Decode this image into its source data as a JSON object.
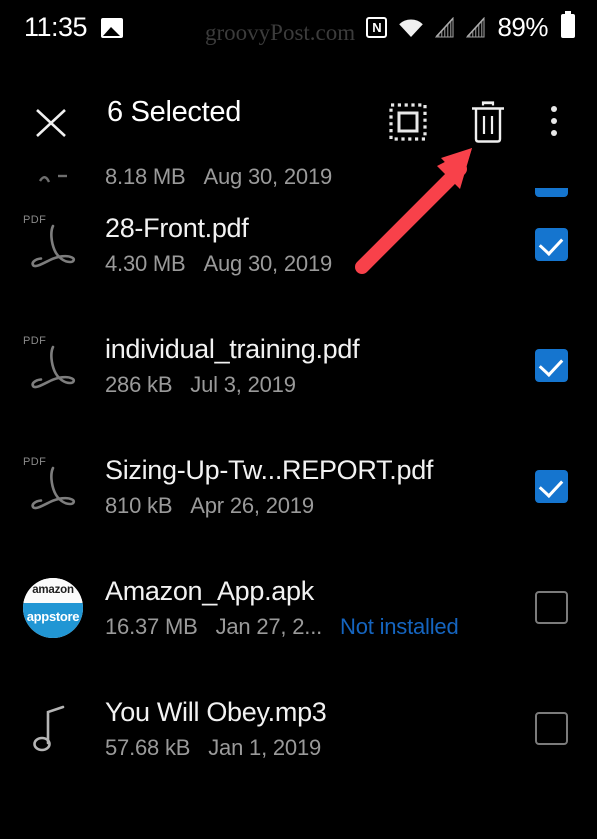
{
  "status_bar": {
    "time": "11:35",
    "battery_percent": "89%",
    "icons": [
      "image-icon",
      "nfc-icon",
      "wifi-icon",
      "signal-off-icon",
      "signal-off-icon",
      "battery-icon"
    ]
  },
  "watermark": {
    "text": "groovyPost.com"
  },
  "action_bar": {
    "close_label": "close-icon",
    "title": "6 Selected",
    "select_all_label": "select-all-icon",
    "delete_label": "delete-icon",
    "overflow_label": "more-options-icon"
  },
  "colors": {
    "accent_blue": "#1575cf",
    "link_blue": "#1565c0",
    "arrow_red": "#f8414a",
    "background": "#000000",
    "title_text": "#f2f2f2",
    "meta_text": "#9a9a9a"
  },
  "files": [
    {
      "name": "",
      "size": "8.18 MB",
      "date": "Aug 30, 2019",
      "note": "",
      "icon": "file-icon",
      "checked": true,
      "clipped": true
    },
    {
      "name": "28-Front.pdf",
      "size": "4.30 MB",
      "date": "Aug 30, 2019",
      "note": "",
      "icon": "pdf-icon",
      "checked": true,
      "clipped": false
    },
    {
      "name": "individual_training.pdf",
      "size": "286 kB",
      "date": "Jul 3, 2019",
      "note": "",
      "icon": "pdf-icon",
      "checked": true,
      "clipped": false
    },
    {
      "name": "Sizing-Up-Tw...REPORT.pdf",
      "size": "810 kB",
      "date": "Apr 26, 2019",
      "note": "",
      "icon": "pdf-icon",
      "checked": true,
      "clipped": false
    },
    {
      "name": "Amazon_App.apk",
      "size": "16.37 MB",
      "date": "Jan 27, 2...",
      "note": "Not installed",
      "icon": "amazon-appstore-icon",
      "checked": false,
      "clipped": false
    },
    {
      "name": "You Will Obey.mp3",
      "size": "57.68 kB",
      "date": "Jan 1, 2019",
      "note": "",
      "icon": "music-note-icon",
      "checked": false,
      "clipped": false
    }
  ],
  "annotation": {
    "arrow_label": "red-pointer-arrow",
    "points_to": "delete-icon"
  },
  "amazon_icon_text": {
    "top": "amazon",
    "bottom": "appstore"
  },
  "pdf_icon_text": {
    "label": "PDF"
  }
}
